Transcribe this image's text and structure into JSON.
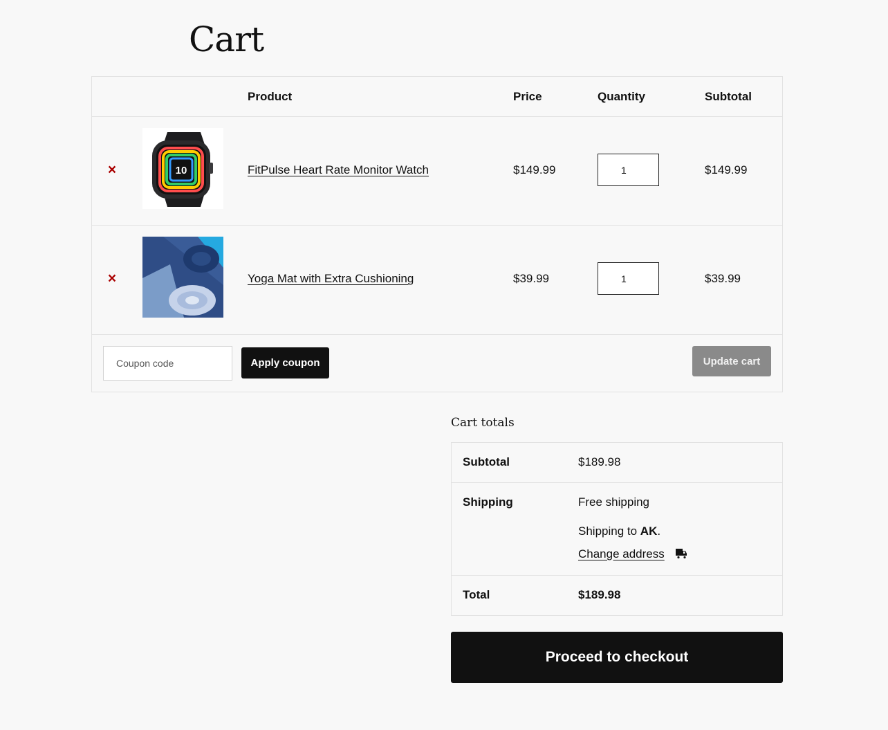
{
  "page": {
    "title": "Cart"
  },
  "table": {
    "headers": {
      "product": "Product",
      "price": "Price",
      "quantity": "Quantity",
      "subtotal": "Subtotal"
    }
  },
  "items": [
    {
      "remove_icon": "×",
      "name": "FitPulse Heart Rate Monitor Watch",
      "price": "$149.99",
      "quantity": "1",
      "subtotal": "$149.99",
      "image_icon": "smartwatch"
    },
    {
      "remove_icon": "×",
      "name": "Yoga Mat with Extra Cushioning",
      "price": "$39.99",
      "quantity": "1",
      "subtotal": "$39.99",
      "image_icon": "yoga-mat"
    }
  ],
  "coupon": {
    "placeholder": "Coupon code",
    "apply_label": "Apply coupon"
  },
  "update_label": "Update cart",
  "totals": {
    "title": "Cart totals",
    "subtotal_label": "Subtotal",
    "subtotal_value": "$189.98",
    "shipping_label": "Shipping",
    "shipping_value": "Free shipping",
    "shipping_to_prefix": "Shipping to ",
    "shipping_to_state": "AK",
    "shipping_to_suffix": ".",
    "change_address": "Change address",
    "total_label": "Total",
    "total_value": "$189.98"
  },
  "checkout_label": "Proceed to checkout",
  "colors": {
    "remove": "#aa0000",
    "primary_button": "#111111",
    "disabled_button": "#8a8a8a",
    "border": "#e2e2e2",
    "background": "#f8f8f8"
  }
}
